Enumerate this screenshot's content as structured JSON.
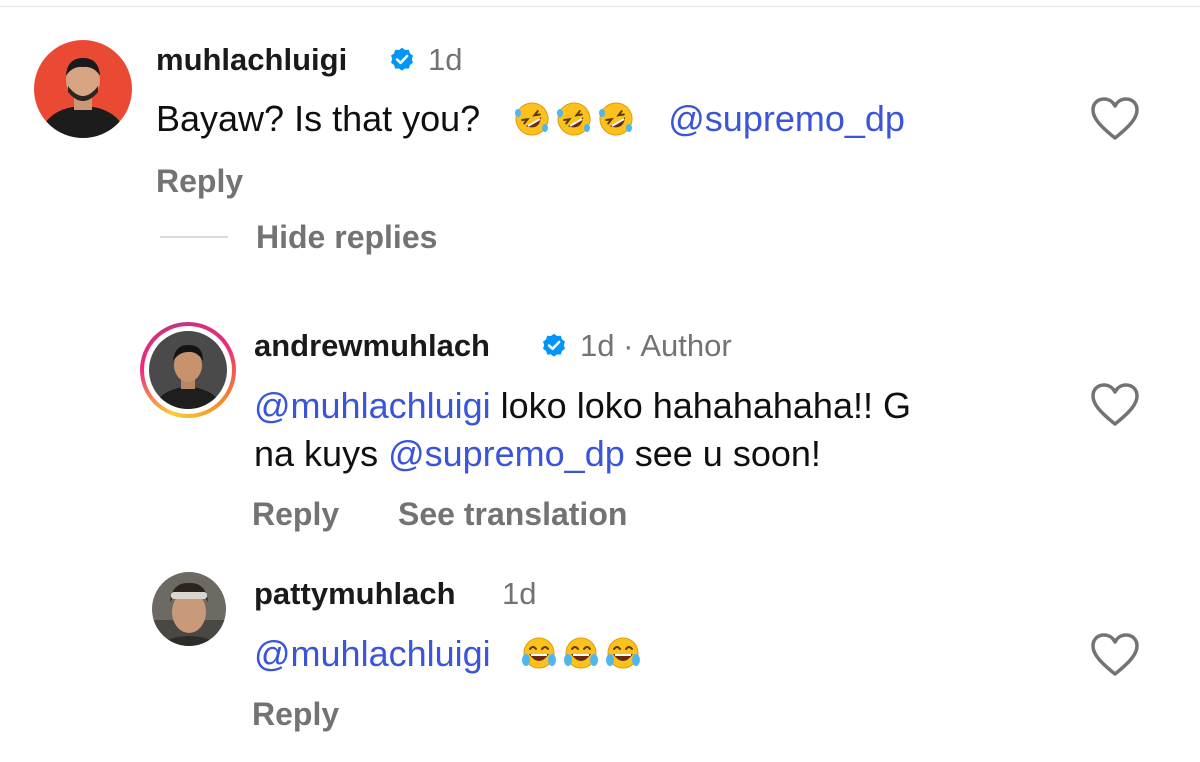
{
  "comments": [
    {
      "username": "muhlachluigi",
      "time": "1d",
      "text": "Bayaw? Is that you?",
      "emojis": [
        "rolling-on-floor-laughing",
        "rolling-on-floor-laughing",
        "rolling-on-floor-laughing"
      ],
      "mention": "@supremo_dp",
      "reply_label": "Reply",
      "hide_replies_label": "Hide replies",
      "avatar_bg": "#ea4a34"
    },
    {
      "username": "andrewmuhlach",
      "time": "1d",
      "author_tag": "· Author",
      "mention1": "@muhlachluigi",
      "text_part1": " loko loko hahahahaha!! G",
      "text_part2": "na kuys ",
      "mention2": "@supremo_dp",
      "text_part3": " see u soon!",
      "reply_label": "Reply",
      "see_translation_label": "See translation"
    },
    {
      "username": "pattymuhlach",
      "time": "1d",
      "mention": "@muhlachluigi",
      "emojis": [
        "face-with-tears-of-joy",
        "face-with-tears-of-joy",
        "face-with-tears-of-joy"
      ],
      "reply_label": "Reply"
    }
  ],
  "colors": {
    "mention": "#3b55d8",
    "verified_badge": "#0095f6",
    "muted_text": "#737373"
  },
  "icons": [
    "verified-badge-icon",
    "heart-icon",
    "emoji-rofl-icon",
    "emoji-tears-of-joy-icon"
  ]
}
